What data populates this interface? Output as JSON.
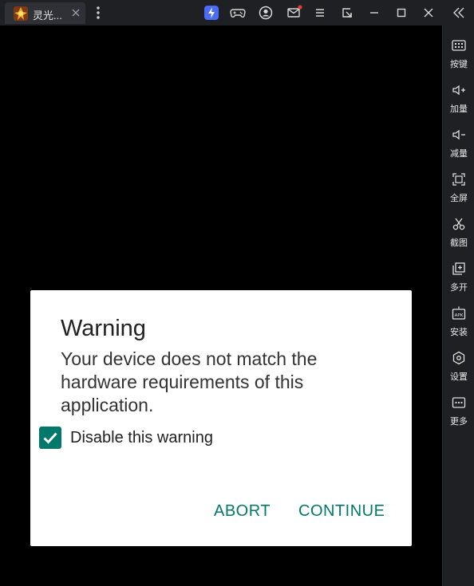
{
  "window": {
    "tab_title": "灵光...",
    "tab_icon": "game-app-icon",
    "toolbar_icons": [
      "boost-icon",
      "gamepad-icon",
      "user-icon",
      "mail-icon",
      "menu-icon",
      "popout-icon",
      "minimize-icon",
      "maximize-icon",
      "close-icon",
      "collapse-sidebar-icon"
    ],
    "mail_badge_color": "#e53935"
  },
  "sidebar": {
    "items": [
      {
        "label": "按键",
        "icon": "keyboard-icon"
      },
      {
        "label": "加量",
        "icon": "volume-up-icon"
      },
      {
        "label": "减量",
        "icon": "volume-down-icon"
      },
      {
        "label": "全屏",
        "icon": "fullscreen-icon"
      },
      {
        "label": "截图",
        "icon": "scissors-icon"
      },
      {
        "label": "多开",
        "icon": "multi-instance-icon"
      },
      {
        "label": "安装",
        "icon": "apk-install-icon"
      },
      {
        "label": "设置",
        "icon": "settings-hexagon-icon"
      },
      {
        "label": "更多",
        "icon": "more-icon"
      }
    ]
  },
  "dialog": {
    "title": "Warning",
    "message": "Your device does not match the hardware requirements of this application.",
    "checkbox_label": "Disable this warning",
    "checkbox_checked": true,
    "abort_label": "ABORT",
    "continue_label": "CONTINUE",
    "accent_color": "#00796b"
  }
}
